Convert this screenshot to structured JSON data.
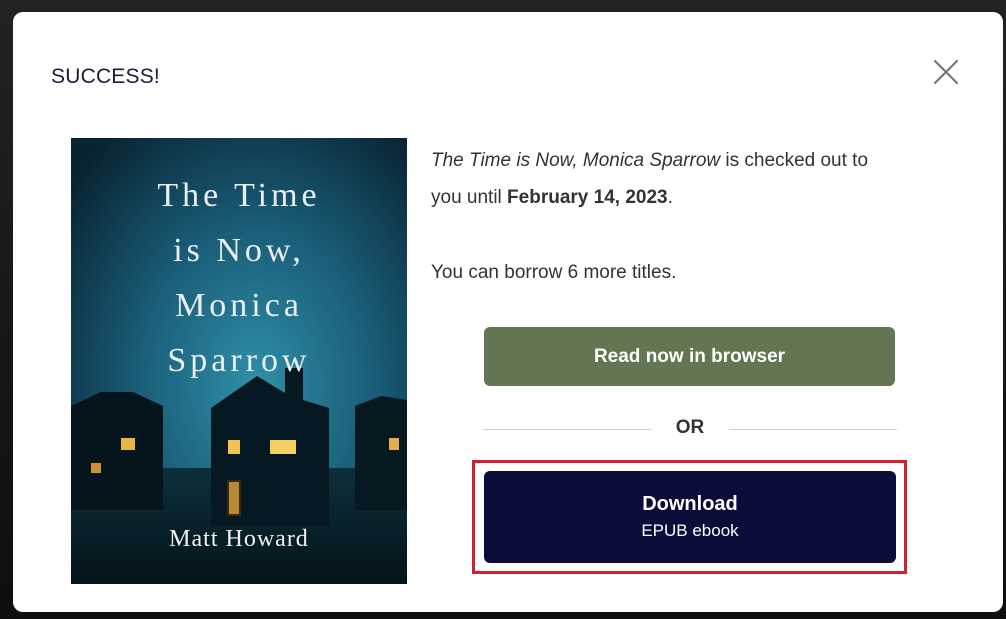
{
  "modal": {
    "title": "SUCCESS!",
    "close_icon": "close-icon"
  },
  "book": {
    "cover_title": "The Time\nis Now,\nMonica\nSparrow",
    "cover_author": "Matt Howard",
    "cover_alt": "The Time is Now, Monica Sparrow"
  },
  "message": {
    "book_title": "The Time is Now, Monica Sparrow",
    "checked_out_text": " is checked out to you until ",
    "due_date": "February 14, 2023",
    "period": ".",
    "borrow_limit": "You can borrow 6 more titles."
  },
  "actions": {
    "read_label": "Read now in browser",
    "or_label": "OR",
    "download_label": "Download",
    "download_format": "EPUB ebook"
  },
  "colors": {
    "read_button": "#637653",
    "download_button": "#0b0c3a",
    "highlight_border": "#d2202e"
  }
}
